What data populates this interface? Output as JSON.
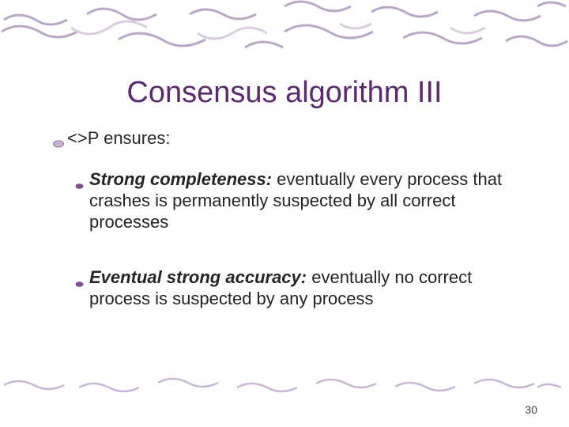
{
  "slide": {
    "title": "Consensus algorithm III",
    "level1": {
      "text": "<>P ensures:"
    },
    "level2": [
      {
        "headline": "Strong completeness:",
        "rest": " eventually every process that crashes is permanently suspected by all correct processes"
      },
      {
        "headline": "Eventual strong accuracy:",
        "rest": " eventually no correct process is suspected by any process"
      }
    ],
    "page_number": "30"
  }
}
